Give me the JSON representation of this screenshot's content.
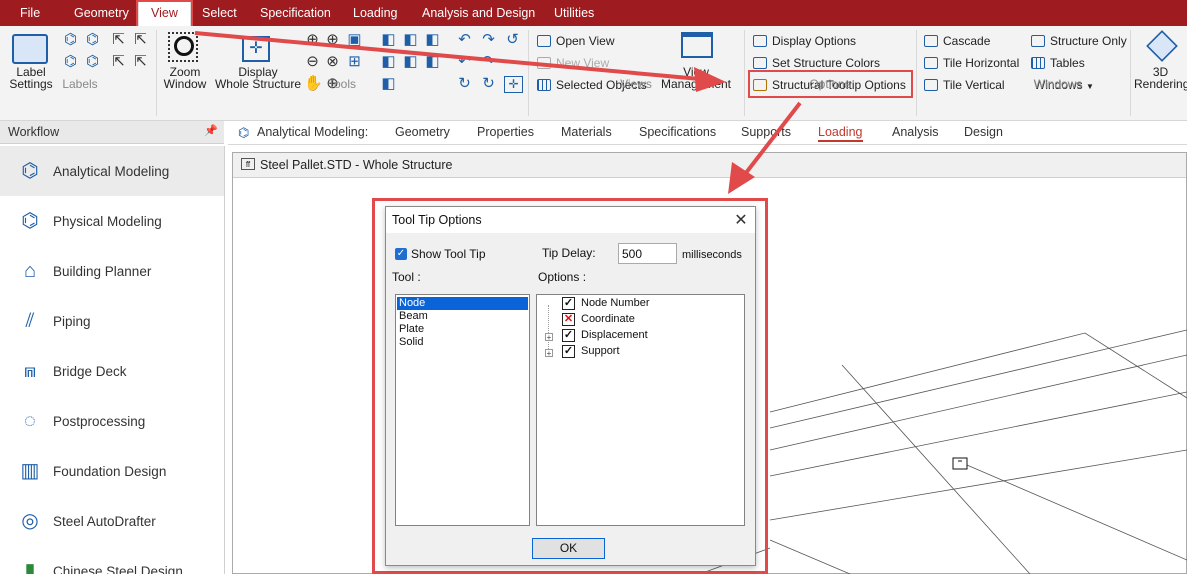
{
  "menu": {
    "items": [
      "File",
      "Geometry",
      "View",
      "Select",
      "Specification",
      "Loading",
      "Analysis and Design",
      "Utilities"
    ],
    "active": "View"
  },
  "ribbon": {
    "labels_group": {
      "label": "Labels",
      "label_settings": "Label\nSettings"
    },
    "tools_group": {
      "label": "Tools",
      "zoom_window": "Zoom\nWindow",
      "display_whole_structure": "Display\nWhole Structure"
    },
    "views_group": {
      "label": "Views",
      "open_view": "Open View",
      "new_view": "New View",
      "selected_objects": "Selected Objects",
      "view_management": "View\nManagement"
    },
    "options_group": {
      "label": "Options",
      "display_options": "Display Options",
      "set_structure_colors": "Set Structure Colors",
      "structural_tooltip_options": "Structural Tooltip Options"
    },
    "windows_group": {
      "label": "Windows",
      "cascade": "Cascade",
      "tile_horizontal": "Tile Horizontal",
      "tile_vertical": "Tile Vertical",
      "structure_only": "Structure Only",
      "tables": "Tables",
      "windows": "Windows"
    },
    "rendering": {
      "label": "3D\nRendering"
    }
  },
  "workflow": {
    "title": "Workflow",
    "items": [
      "Analytical Modeling",
      "Physical Modeling",
      "Building Planner",
      "Piping",
      "Bridge Deck",
      "Postprocessing",
      "Foundation Design",
      "Steel AutoDrafter",
      "Chinese Steel Design"
    ],
    "selected": "Analytical Modeling"
  },
  "tabs": {
    "prefix": "Analytical Modeling:",
    "items": [
      "Geometry",
      "Properties",
      "Materials",
      "Specifications",
      "Supports",
      "Loading",
      "Analysis",
      "Design"
    ],
    "active": "Loading"
  },
  "structure_window": {
    "title": "Steel Pallet.STD - Whole Structure"
  },
  "dialog": {
    "title": "Tool Tip Options",
    "show_tool_tip_label": "Show Tool Tip",
    "show_tool_tip_checked": true,
    "tip_delay_label": "Tip Delay:",
    "tip_delay_value": "500",
    "tip_delay_unit": "milliseconds",
    "tool_label": "Tool :",
    "options_label": "Options :",
    "tools": [
      "Node",
      "Beam",
      "Plate",
      "Solid"
    ],
    "selected_tool": "Node",
    "options": [
      {
        "label": "Node Number",
        "state": "checked",
        "expandable": false
      },
      {
        "label": "Coordinate",
        "state": "crossed",
        "expandable": false
      },
      {
        "label": "Displacement",
        "state": "checked",
        "expandable": true
      },
      {
        "label": "Support",
        "state": "checked",
        "expandable": true
      }
    ],
    "ok_label": "OK"
  },
  "colors": {
    "menu_bar": "#9e1b1f",
    "highlight": "#e04a4a",
    "accent": "#1e5fa8",
    "selection": "#0a64d8"
  }
}
